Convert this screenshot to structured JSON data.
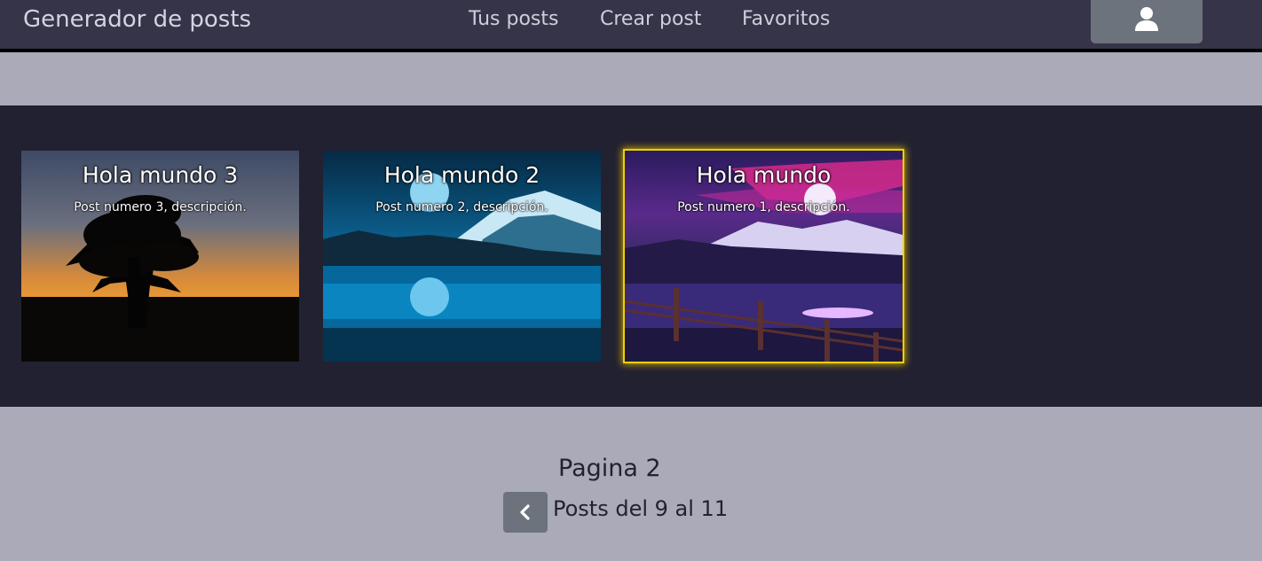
{
  "navbar": {
    "brand": "Generador de posts",
    "links": [
      "Tus posts",
      "Crear post",
      "Favoritos"
    ],
    "user_icon": "user-icon"
  },
  "posts": [
    {
      "title": "Hola mundo 3",
      "description": "Post numero 3, descripción."
    },
    {
      "title": "Hola mundo 2",
      "description": "Post numero 2, descripción."
    },
    {
      "title": "Hola mundo",
      "description": "Post numero 1, descripción."
    }
  ],
  "pagination": {
    "page_label": "Pagina 2",
    "range_label": "Posts del 9 al 11",
    "prev_icon": "chevron-left-icon"
  },
  "colors": {
    "navbar_bg": "#353448",
    "page_bg": "#abaab8",
    "strip_bg": "#222131",
    "button_bg": "#6c737d",
    "highlight": "#f0d000"
  }
}
